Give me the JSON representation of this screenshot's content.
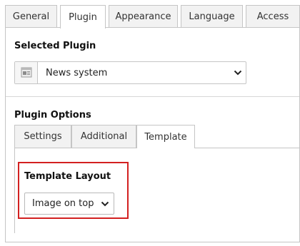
{
  "tabs": [
    {
      "label": "General",
      "active": false
    },
    {
      "label": "Plugin",
      "active": true
    },
    {
      "label": "Appearance",
      "active": false
    },
    {
      "label": "Language",
      "active": false
    },
    {
      "label": "Access",
      "active": false
    }
  ],
  "selected_plugin": {
    "title": "Selected Plugin",
    "value": "News system",
    "icon": "plugin-page-icon"
  },
  "plugin_options": {
    "title": "Plugin Options",
    "tabs": [
      {
        "label": "Settings",
        "active": false
      },
      {
        "label": "Additional",
        "active": false
      },
      {
        "label": "Template",
        "active": true
      }
    ],
    "template_layout": {
      "label": "Template Layout",
      "value": "Image on top"
    }
  },
  "colors": {
    "highlight": "#d32020",
    "border": "#c5c5c5",
    "tab_inactive_bg": "#f2f2f2"
  }
}
